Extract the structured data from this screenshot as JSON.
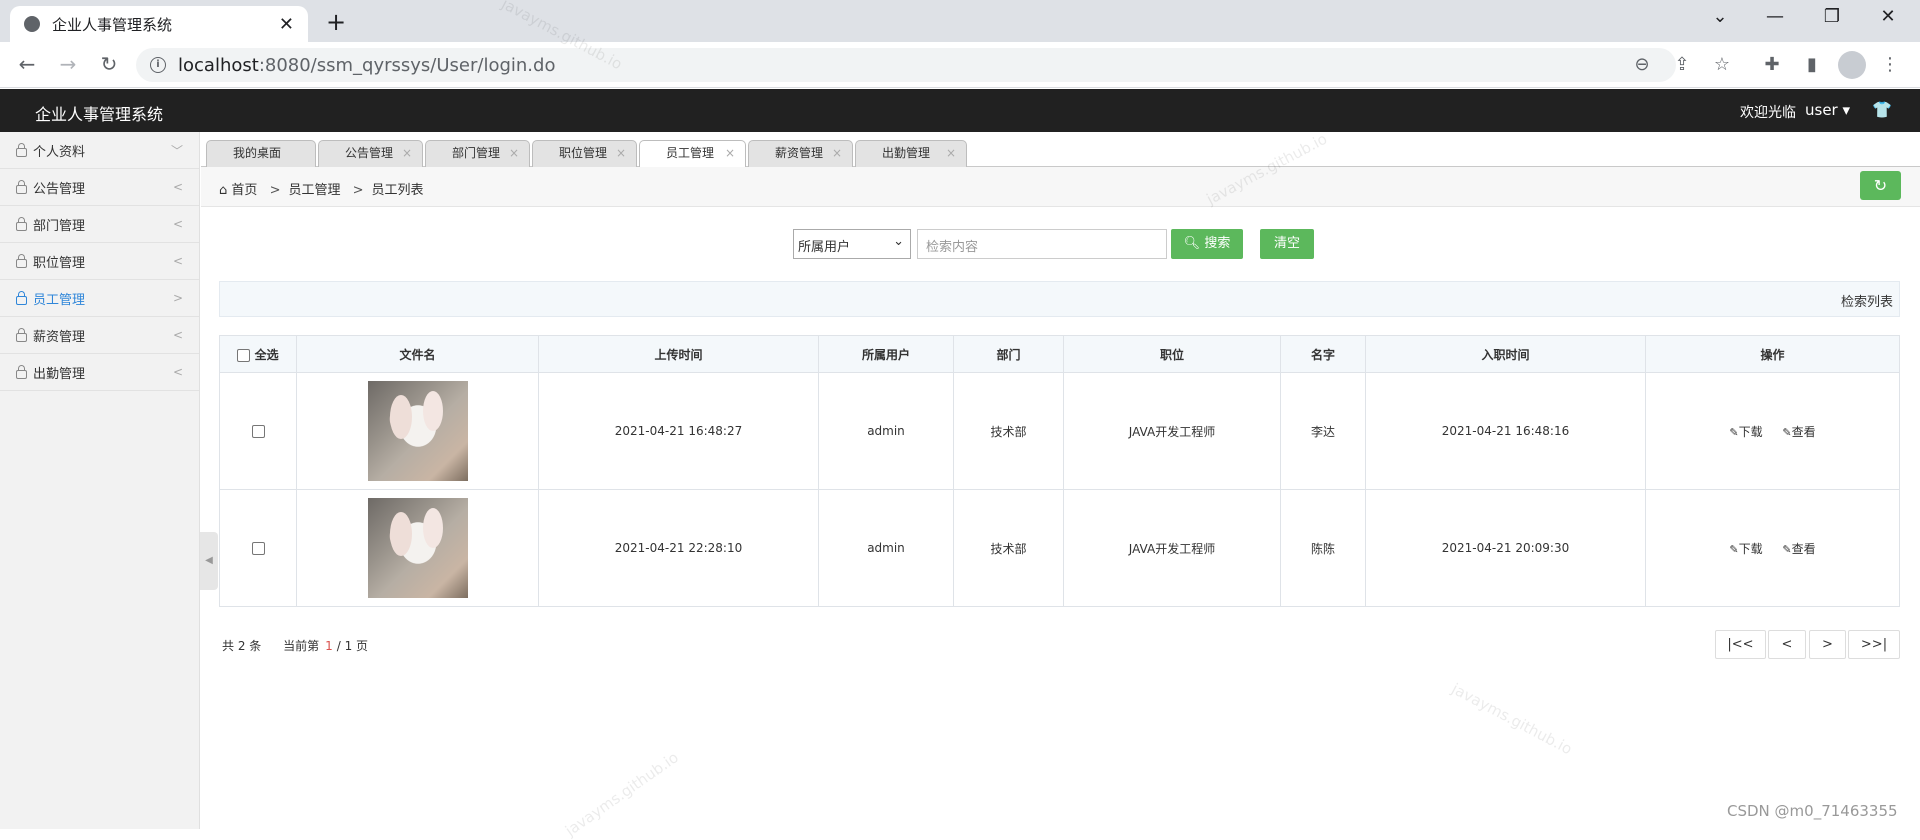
{
  "browser": {
    "tab_title": "企业人事管理系统",
    "url_host": "localhost",
    "url_rest": ":8080/ssm_qyrssys/User/login.do"
  },
  "app": {
    "brand": "企业人事管理系统",
    "welcome": "欢迎光临",
    "user": "user ▾"
  },
  "sidebar": {
    "items": [
      {
        "label": "个人资料",
        "arrow": "﹀"
      },
      {
        "label": "公告管理",
        "arrow": "<"
      },
      {
        "label": "部门管理",
        "arrow": "<"
      },
      {
        "label": "职位管理",
        "arrow": "<"
      },
      {
        "label": "员工管理",
        "arrow": ">"
      },
      {
        "label": "薪资管理",
        "arrow": "<"
      },
      {
        "label": "出勤管理",
        "arrow": "<"
      }
    ]
  },
  "tabs": [
    "我的桌面",
    "公告管理",
    "部门管理",
    "职位管理",
    "员工管理",
    "薪资管理",
    "出勤管理"
  ],
  "breadcrumb": {
    "home": "首页",
    "level1": "员工管理",
    "level2": "员工列表"
  },
  "search": {
    "select_value": "所属用户",
    "placeholder": "检索内容",
    "search_label": "搜索",
    "clear_label": "清空"
  },
  "result_title": "检索列表",
  "table": {
    "headers": {
      "select_all": "全选",
      "file": "文件名",
      "upload_time": "上传时间",
      "owner": "所属用户",
      "dept": "部门",
      "position": "职位",
      "name": "名字",
      "join_time": "入职时间",
      "ops": "操作"
    },
    "rows": [
      {
        "upload_time": "2021-04-21 16:48:27",
        "owner": "admin",
        "dept": "技术部",
        "position": "JAVA开发工程师",
        "name": "李达",
        "join_time": "2021-04-21 16:48:16",
        "download": "下载",
        "view": "查看"
      },
      {
        "upload_time": "2021-04-21 22:28:10",
        "owner": "admin",
        "dept": "技术部",
        "position": "JAVA开发工程师",
        "name": "陈陈",
        "join_time": "2021-04-21 20:09:30",
        "download": "下载",
        "view": "查看"
      }
    ]
  },
  "pager": {
    "total_text": "共 2 条",
    "current_prefix": "当前第",
    "current_page": "1",
    "page_suffix": "/ 1 页",
    "first": "|<<",
    "prev": "<",
    "next": ">",
    "last": ">>|"
  },
  "watermark_text": "javayms.github.io",
  "footer_credit": "CSDN @m0_71463355",
  "colors": {
    "accent_green": "#5cb85c",
    "header_dark": "#212121",
    "active_blue": "#2f86d9"
  }
}
